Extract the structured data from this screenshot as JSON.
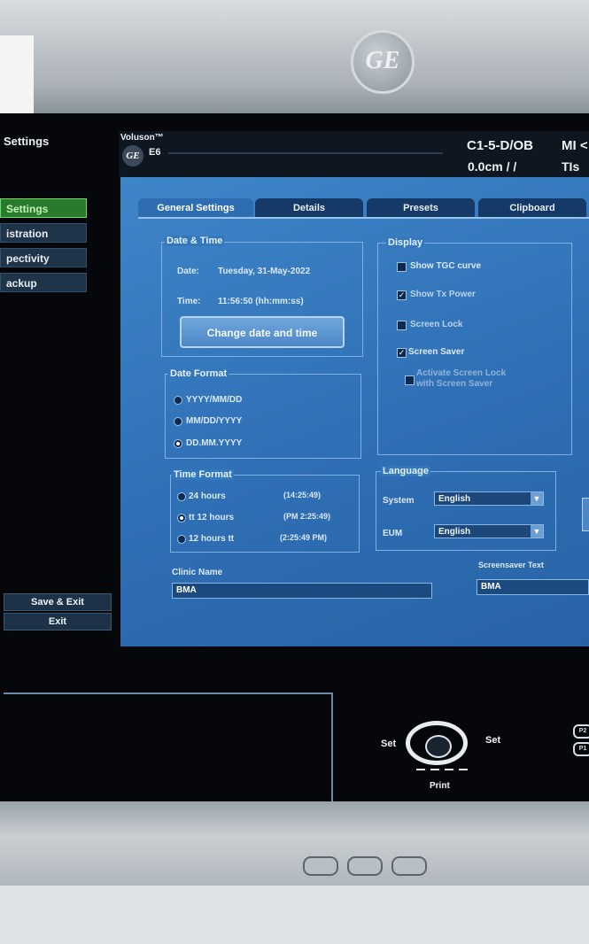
{
  "monitor": {
    "brand_logo": "GE"
  },
  "sidebar": {
    "title": "Settings",
    "items": [
      {
        "label": "Settings",
        "active": true
      },
      {
        "label": "istration"
      },
      {
        "label": "pectivity"
      },
      {
        "label": "ackup"
      }
    ],
    "save_exit_label": "Save & Exit",
    "exit_label": "Exit"
  },
  "header": {
    "product": "Voluson™",
    "model": "E6",
    "probe": "C1-5-D/OB",
    "depth": "0.0cm / /",
    "mi": "MI <",
    "tis": "TIs <"
  },
  "tabs": [
    {
      "label": "General Settings",
      "active": true
    },
    {
      "label": "Details"
    },
    {
      "label": "Presets"
    },
    {
      "label": "Clipboard"
    }
  ],
  "date_time": {
    "title": "Date & Time",
    "date_label": "Date:",
    "date_value": "Tuesday, 31-May-2022",
    "time_label": "Time:",
    "time_value": "11:56:50 (hh:mm:ss)",
    "change_button": "Change date and time"
  },
  "date_format": {
    "title": "Date Format",
    "options": [
      {
        "label": "YYYY/MM/DD",
        "selected": false
      },
      {
        "label": "MM/DD/YYYY",
        "selected": false
      },
      {
        "label": "DD.MM.YYYY",
        "selected": true
      }
    ]
  },
  "time_format": {
    "title": "Time Format",
    "options": [
      {
        "label": "24 hours",
        "example": "(14:25:49)",
        "selected": false
      },
      {
        "label": "tt 12 hours",
        "example": "(PM 2:25:49)",
        "selected": true
      },
      {
        "label": "12 hours tt",
        "example": "(2:25:49 PM)",
        "selected": false
      }
    ]
  },
  "display": {
    "title": "Display",
    "options": [
      {
        "label": "Show TGC curve",
        "checked": false
      },
      {
        "label": "Show Tx Power",
        "checked": true
      },
      {
        "label": "Screen Lock",
        "checked": false
      },
      {
        "label": "Screen Saver",
        "checked": true
      },
      {
        "label": "Activate Screen Lock with Screen Saver",
        "checked": false
      }
    ]
  },
  "language": {
    "title": "Language",
    "system_label": "System",
    "system_value": "English",
    "eum_label": "EUM",
    "eum_value": "English"
  },
  "clinic": {
    "label": "Clinic Name",
    "value": "BMA"
  },
  "screensaver": {
    "label": "Screensaver Text",
    "value": "BMA"
  },
  "knob": {
    "set_left": "Set",
    "set_right": "Set",
    "print": "Print",
    "p2": "P2",
    "p1": "P1"
  }
}
